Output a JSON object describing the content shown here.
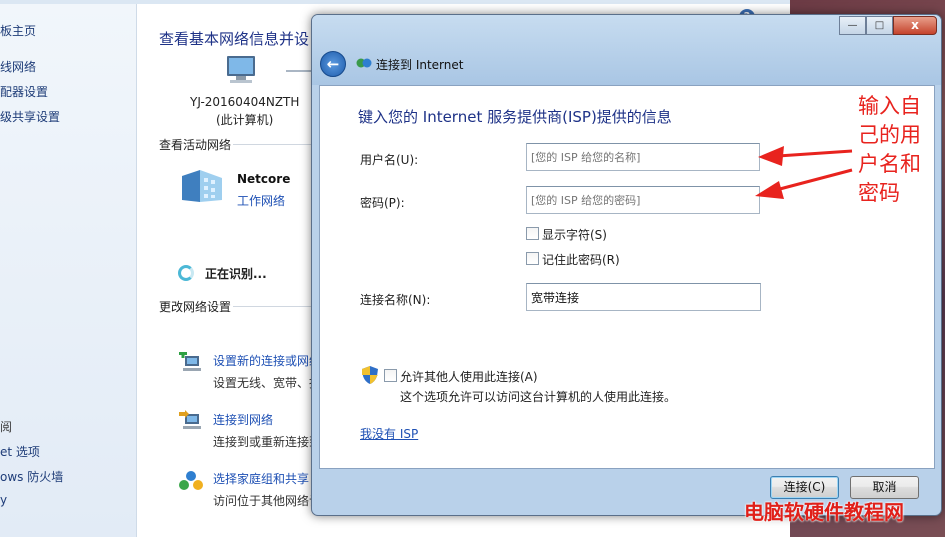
{
  "sidebar": {
    "items": [
      "板主页",
      "线网络",
      "配器设置",
      "级共享设置"
    ],
    "see_also": [
      "阅",
      "et 选项",
      "ows 防火墙",
      "y"
    ]
  },
  "network_center": {
    "title": "查看基本网络信息并设",
    "computer_name": "YJ-20160404NZTH",
    "computer_sub": "(此计算机)",
    "active_networks_label": "查看活动网络",
    "network_name": "Netcore",
    "network_type": "工作网络",
    "identifying": "正在识别...",
    "change_settings_label": "更改网络设置",
    "tasks": [
      {
        "link": "设置新的连接或网络",
        "desc": "设置无线、宽带、拨"
      },
      {
        "link": "连接到网络",
        "desc": "连接到或重新连接到"
      },
      {
        "link": "选择家庭组和共享",
        "desc": "访问位于其他网络计"
      }
    ],
    "help_glyph": "?"
  },
  "dialog": {
    "title": "连接到 Internet",
    "heading": "键入您的 Internet 服务提供商(ISP)提供的信息",
    "username_label": "用户名(U):",
    "username_placeholder": "[您的 ISP 给您的名称]",
    "password_label": "密码(P):",
    "password_placeholder": "[您的 ISP 给您的密码]",
    "show_chars_label": "显示字符(S)",
    "remember_password_label": "记住此密码(R)",
    "connection_name_label": "连接名称(N):",
    "connection_name_value": "宽带连接",
    "allow_others_label": "允许其他人使用此连接(A)",
    "allow_others_desc": "这个选项允许可以访问这台计算机的人使用此连接。",
    "no_isp_link": "我没有 ISP",
    "connect_button": "连接(C)",
    "cancel_button": "取消",
    "window_buttons": {
      "minimize": "—",
      "maximize": "□",
      "close": "x"
    },
    "back_glyph": "←"
  },
  "annotation": {
    "text": "输入自己的用户名和密码",
    "color": "#e8231e"
  },
  "watermark": "电脑软硬件教程网"
}
